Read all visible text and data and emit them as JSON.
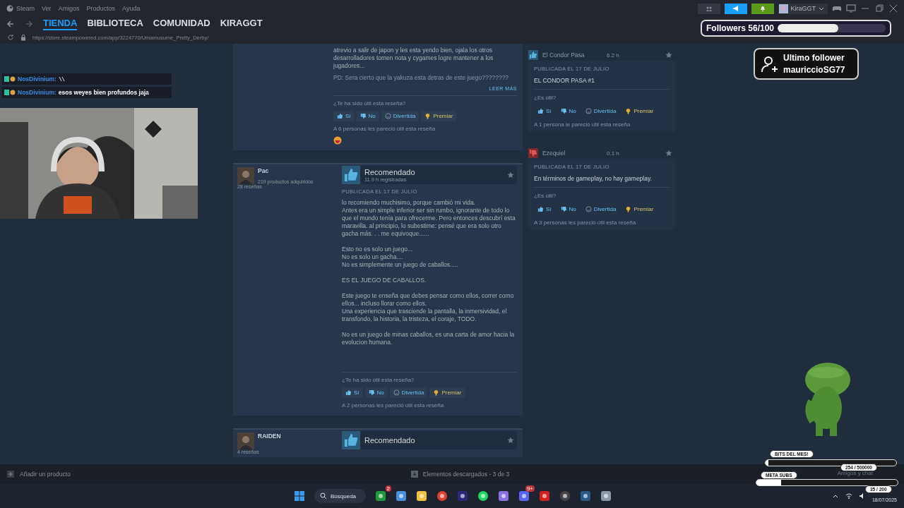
{
  "menu": [
    "Steam",
    "Ver",
    "Amigos",
    "Productos",
    "Ayuda"
  ],
  "account": {
    "name": "KiraGGT"
  },
  "nav_tabs": [
    {
      "label": "TIENDA",
      "selected": true
    },
    {
      "label": "BIBLIOTECA",
      "selected": false
    },
    {
      "label": "COMUNIDAD",
      "selected": false
    },
    {
      "label": "KIRAGGT",
      "selected": false
    }
  ],
  "url": "https://store.steampowered.com/app/3224770/Umamusume_Pretty_Derby/",
  "chat": [
    {
      "user": "NosDivinium:",
      "kind": "emote"
    },
    {
      "user": "NosDivinium:",
      "kind": "text",
      "text": "esos weyes bien profundos jaja"
    }
  ],
  "top_review": {
    "body": "atrevio a salir de japon y les esta yendo bien, ojala los otros desarrolladores tomen nota y cygames logre mantener a los jugadores...",
    "faded": "PD: Sera cierto que la yakuza esta detras de este juego????????",
    "read_more": "LEER MÁS",
    "question": "¿Te ha sido útil esta reseña?",
    "buttons": [
      {
        "label": "Sí",
        "kind": "yes"
      },
      {
        "label": "No",
        "kind": "no"
      },
      {
        "label": "Divertida",
        "kind": "funny"
      },
      {
        "label": "Premiar",
        "kind": "award"
      }
    ],
    "helpful": "A 6 personas les pareció útil esta reseña"
  },
  "reviews": [
    {
      "author": "Pac",
      "products": "219 productos adquiridos",
      "count": "28 reseñas",
      "recommended": true,
      "verdict": "Recomendado",
      "hours": "11.9 h registradas",
      "date": "PUBLICADA EL 17 DE JULIO",
      "paragraphs": [
        "lo recomiendo muchisimo, porque cambió mi vida.\nAntes era un simple inferior ser sin rumbo, ignorante de todo lo que el mundo tenía para ofrecerme. Pero entonces descubrí esta maravilla. al principio, lo subestime: pensé que era solo otro gacha más. . . me equivoque......",
        "Esto no es solo un juego...\nNo es solo un gacha....\nNo es simplemente un juego de caballos.....",
        "ES EL JUEGO DE CABALLOS.",
        "Este juego te enseña que debes pensar como ellos, correr como ellos... incluso llorar como ellos.\nUna experiencia que trasciende la pantalla, la inmersividad, el transfondo, la historia, la tristeza, el coraje, TODO.",
        "No es un juego de minas caballos, es una carta de amor hacia la evolucion humana."
      ],
      "question": "¿Te ha sido útil esta reseña?",
      "buttons": [
        {
          "label": "Sí",
          "kind": "yes"
        },
        {
          "label": "No",
          "kind": "no"
        },
        {
          "label": "Divertida",
          "kind": "funny"
        },
        {
          "label": "Premiar",
          "kind": "award"
        }
      ],
      "helpful": "A 2 personas les pareció útil esta reseña"
    },
    {
      "author": "RAIDEN",
      "count": "4 reseñas",
      "recommended": true,
      "verdict": "Recomendado"
    }
  ],
  "side_reviews": [
    {
      "author": "El Condor Pasa",
      "recommended": true,
      "hours": "6.2 h",
      "date": "PUBLICADA EL 17 DE JULIO",
      "text": "EL CONDOR PASA #1",
      "question": "¿Es útil?",
      "buttons": [
        {
          "label": "Sí",
          "kind": "yes"
        },
        {
          "label": "No",
          "kind": "no"
        },
        {
          "label": "Divertida",
          "kind": "funny"
        },
        {
          "label": "Premiar",
          "kind": "award"
        }
      ],
      "helpful": "A 1 persona le pareció útil esta reseña"
    },
    {
      "author": "Ezequiel",
      "recommended": false,
      "hours": "0.1 h",
      "date": "PUBLICADA EL 17 DE JULIO",
      "text": "En términos de gameplay, no hay gameplay.",
      "question": "¿Es útil?",
      "buttons": [
        {
          "label": "Sí",
          "kind": "yes"
        },
        {
          "label": "No",
          "kind": "no"
        },
        {
          "label": "Divertida",
          "kind": "funny"
        },
        {
          "label": "Premiar",
          "kind": "award"
        }
      ],
      "helpful": "A 3 personas les pareció útil esta reseña"
    }
  ],
  "followers": {
    "label": "Followers 56/100",
    "level": 0.56
  },
  "last_follower": {
    "title": "Ultimo follower",
    "name": "mauriccioSG77"
  },
  "bits": {
    "label": "BITS DEL MES!",
    "reading": "254 / 500000",
    "level": 0.02
  },
  "subs": {
    "label": "META SUBS",
    "reading": "35 / 200",
    "level": 0.175
  },
  "bottom_bar": {
    "add": "Añadir un producto",
    "downloads": "Elementos descargados - 3 de 3",
    "friends": "Amigos y chat"
  },
  "taskbar": {
    "search": "Búsqueda",
    "apps": [
      {
        "kind": "xbox",
        "badge": "2"
      },
      {
        "kind": "store"
      },
      {
        "kind": "folder"
      },
      {
        "kind": "chrome"
      },
      {
        "kind": "premiere"
      },
      {
        "kind": "spotify"
      },
      {
        "kind": "grid"
      },
      {
        "kind": "discord",
        "badge": "9+"
      },
      {
        "kind": "red"
      },
      {
        "kind": "obs"
      },
      {
        "kind": "steam"
      },
      {
        "kind": "gear"
      }
    ],
    "date": "18/07/2025"
  }
}
